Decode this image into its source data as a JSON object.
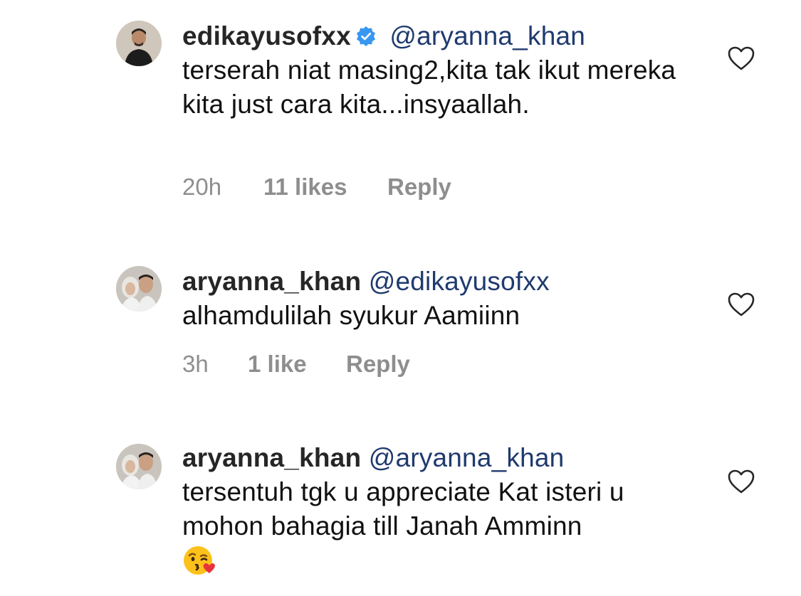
{
  "comments": [
    {
      "username": "edikayusofxx",
      "verified": true,
      "mention": "@aryanna_khan",
      "text": "terserah niat masing2,kita tak ikut mereka kita just cara kita...insyaallah.",
      "time": "20h",
      "likes": "11 likes",
      "reply": "Reply"
    },
    {
      "username": "aryanna_khan",
      "verified": false,
      "mention": "@edikayusofxx",
      "text": "alhamdulilah syukur Aamiinn",
      "time": "3h",
      "likes": "1 like",
      "reply": "Reply"
    },
    {
      "username": "aryanna_khan",
      "verified": false,
      "mention": "@aryanna_khan",
      "text": "tersentuh tgk u appreciate Kat isteri u mohon bahagia till Janah Amminn",
      "emoji": "kissing-face-with-heart-emoji",
      "time": "",
      "likes": "",
      "reply": ""
    }
  ],
  "colors": {
    "mention": "#1f3a6e",
    "meta": "#8e8e8e",
    "verified": "#3897f0"
  }
}
